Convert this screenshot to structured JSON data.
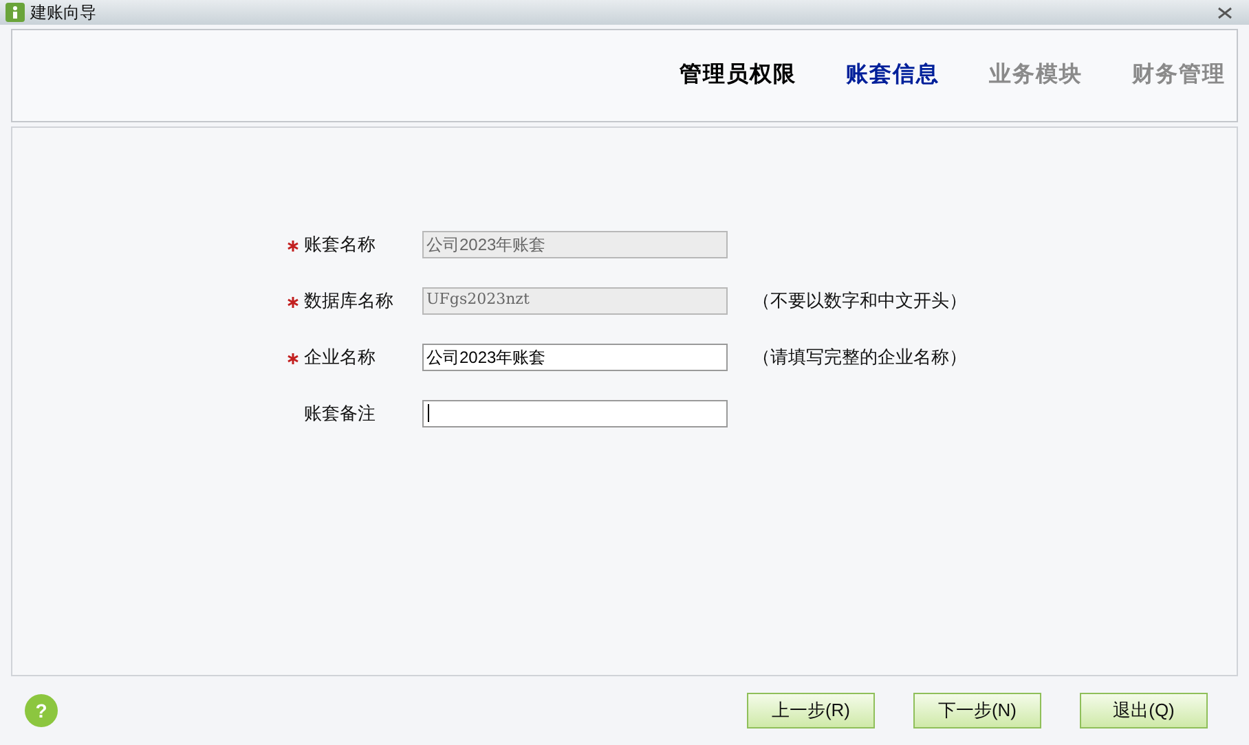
{
  "window": {
    "title": "建账向导"
  },
  "steps": [
    {
      "label": "管理员权限",
      "selected": false,
      "completed": true
    },
    {
      "label": "账套信息",
      "selected": true,
      "completed": false
    },
    {
      "label": "业务模块",
      "selected": false,
      "completed": false
    },
    {
      "label": "财务管理",
      "selected": false,
      "completed": false
    }
  ],
  "fields": [
    {
      "label": "账套名称",
      "required": true,
      "value": "公司2023年账套",
      "disabled": true
    },
    {
      "label": "数据库名称",
      "required": true,
      "value": "UFgs2023nzt",
      "disabled": true,
      "hint": "（不要以数字和中文开头）"
    },
    {
      "label": "企业名称",
      "required": true,
      "value": "公司2023年账套",
      "disabled": false,
      "hint": "（请填写完整的企业名称）"
    },
    {
      "label": "账套备注",
      "required": false,
      "disabled": false,
      "focused": true
    }
  ],
  "help": "?",
  "buttons": [
    "上一步(R)",
    "下一步(N)",
    "退出(Q)"
  ]
}
